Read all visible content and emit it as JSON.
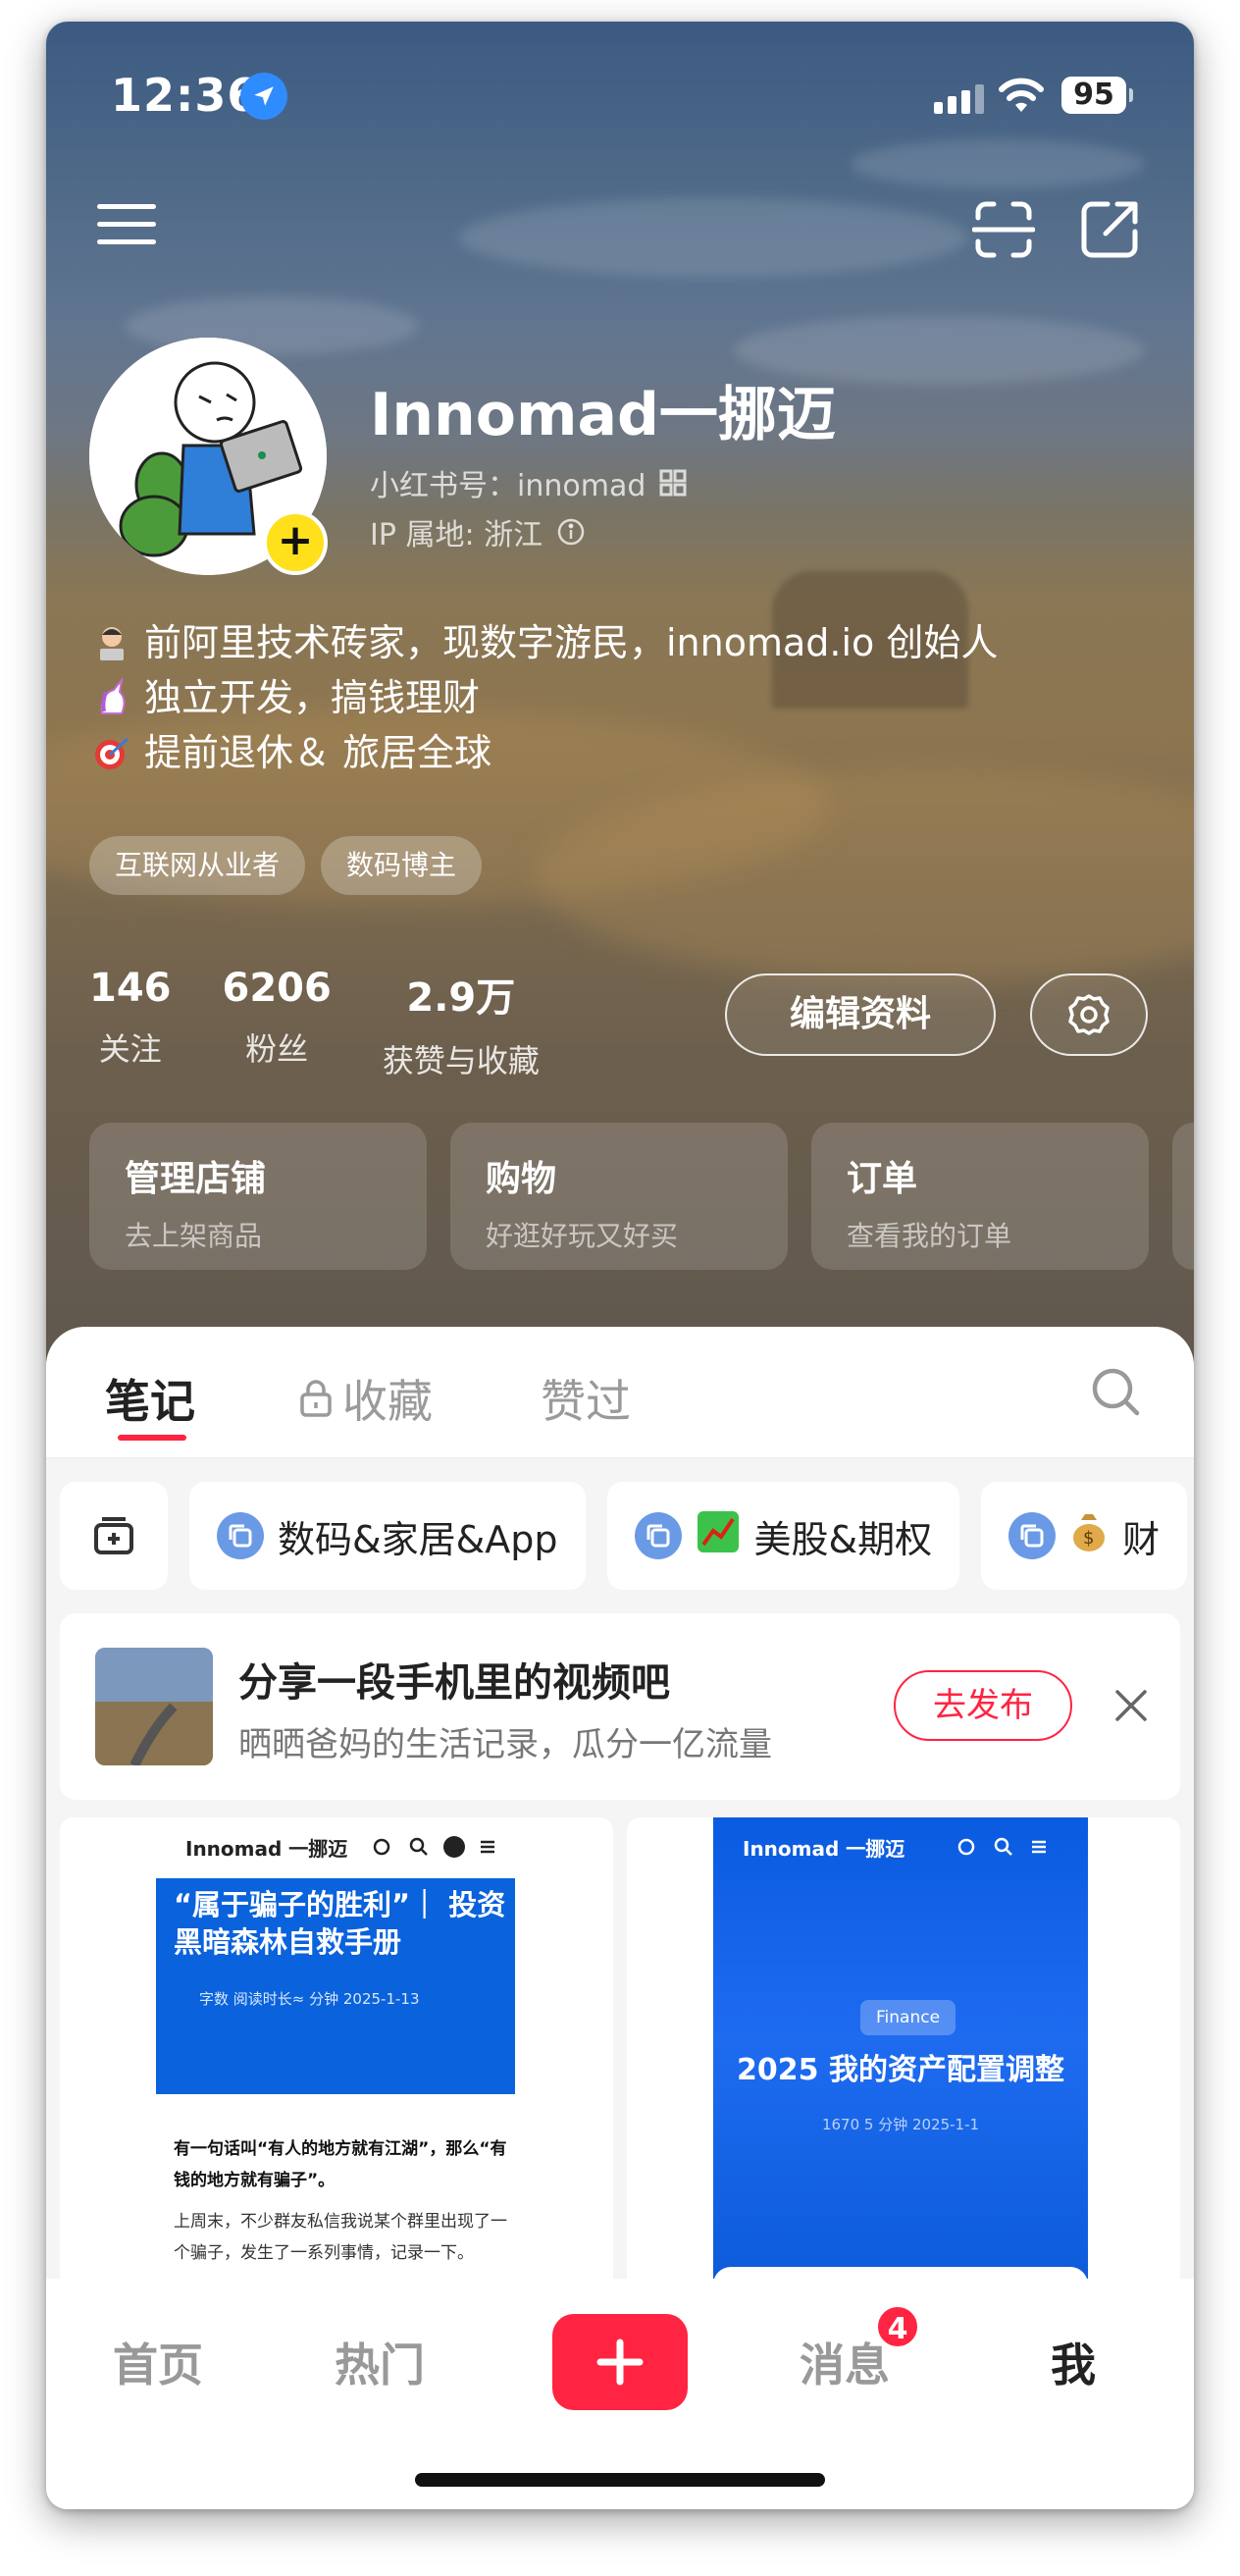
{
  "status_bar": {
    "time": "12:36",
    "battery": "95"
  },
  "profile": {
    "name": "Innomad一挪迈",
    "red_id_label": "小红书号：innomad",
    "ip_location": "IP 属地: 浙江",
    "bio": [
      {
        "icon": "technologist-emoji",
        "text": "前阿里技术砖家，现数字游民，innomad.io 创始人"
      },
      {
        "icon": "unicorn-emoji",
        "text": "独立开发，搞钱理财"
      },
      {
        "icon": "dart-target-emoji",
        "text": "提前退休＆ 旅居全球"
      }
    ],
    "tags": [
      "互联网从业者",
      "数码博主"
    ],
    "stats": [
      {
        "value": "146",
        "label": "关注"
      },
      {
        "value": "6206",
        "label": "粉丝"
      },
      {
        "value": "2.9万",
        "label": "获赞与收藏"
      }
    ],
    "edit_button": "编辑资料"
  },
  "cards": [
    {
      "title": "管理店铺",
      "subtitle": "去上架商品"
    },
    {
      "title": "购物",
      "subtitle": "好逛好玩又好买"
    },
    {
      "title": "订单",
      "subtitle": "查看我的订单"
    }
  ],
  "tabs": [
    {
      "label": "笔记",
      "active": true
    },
    {
      "label": "收藏",
      "active": false
    },
    {
      "label": "赞过",
      "active": false
    }
  ],
  "albums": [
    {
      "label": "数码&家居&App"
    },
    {
      "label": "美股&期权",
      "emoji": "chart-increasing-emoji"
    },
    {
      "label": "财",
      "emoji": "money-bag-emoji"
    }
  ],
  "promo": {
    "title": "分享一段手机里的视频吧",
    "subtitle": "晒晒爸妈的生活记录，瓜分一亿流量",
    "button": "去发布"
  },
  "notes": [
    {
      "brand": "Innomad 一挪迈",
      "title": "“属于骗子的胜利”｜ 投资黑暗森林自救手册",
      "meta": "字数   阅读时长≈  分钟   2025-1-13",
      "body_bold": "有一句话叫“有人的地方就有江湖”，那么“有钱的地方就有骗子”。",
      "body": "上周末，不少群友私信我说某个群里出现了一个骗子，发生了一系列事情，记录一下。"
    },
    {
      "brand": "Innomad 一挪迈",
      "badge": "Finance",
      "title": "2025 我的资产配置调整",
      "meta": "1670   5 分钟   2025-1-1"
    }
  ],
  "bottom_nav": {
    "items": [
      "首页",
      "热门",
      "消息",
      "我"
    ],
    "message_badge": "4"
  },
  "colors": {
    "accent": "#ff2442",
    "note_blue": "#0a62dd",
    "tag_bg": "rgba(255,255,255,0.25)"
  }
}
